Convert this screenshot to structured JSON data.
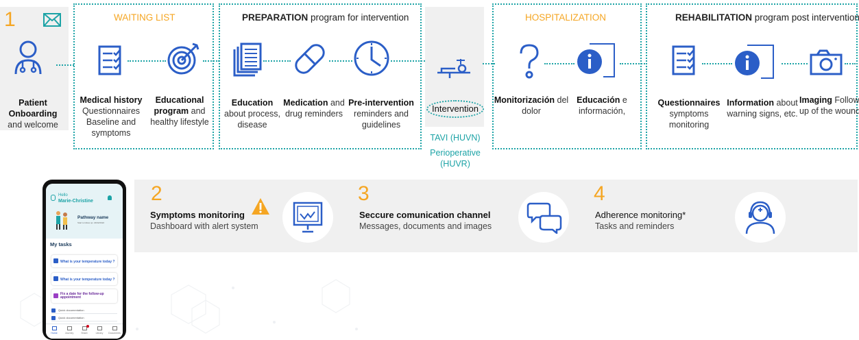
{
  "colors": {
    "accent_teal": "#1ca3a6",
    "orange": "#f5a623",
    "blue": "#2b5ec7",
    "panel_grey": "#f0f0f0"
  },
  "step1": {
    "number": "1",
    "mail_icon": "envelope-icon",
    "onboarding": {
      "icon": "doctor-icon",
      "line1": "Patient",
      "line2": "Onboarding",
      "line3": "and welcome"
    }
  },
  "waiting_list": {
    "title": "WAITING LIST",
    "items": [
      {
        "icon": "checklist-icon",
        "bold": "Medical history",
        "lines": [
          "Questionnaires",
          "Baseline and",
          "symptoms"
        ]
      },
      {
        "icon": "target-icon",
        "bold": "Educational",
        "bold2": "program",
        "rest": "and",
        "lines": [
          "healthy lifestyle"
        ]
      }
    ]
  },
  "preparation": {
    "title_bold": "PREPARATION",
    "title_rest": "program for intervention",
    "items": [
      {
        "icon": "documents-icon",
        "bold": "Education",
        "lines": [
          "about process,",
          "disease"
        ]
      },
      {
        "icon": "pill-icon",
        "bold": "Medication",
        "rest": "and",
        "lines": [
          "drug reminders"
        ]
      },
      {
        "icon": "clock-icon",
        "bold": "Pre-intervention",
        "lines": [
          "reminders and",
          "guidelines"
        ]
      }
    ]
  },
  "intervention": {
    "icon": "surgery-bed-icon",
    "label": "Intervention",
    "tavi": "TAVI (HUVN)",
    "periop1": "Perioperative",
    "periop2": "(HUVR)"
  },
  "hospitalization": {
    "title": "HOSPITALIZATION",
    "items": [
      {
        "icon": "question-icon",
        "bold": "Monitorización",
        "rest": "del",
        "lines": [
          "dolor"
        ]
      },
      {
        "icon": "info-icon",
        "bold": "Educación",
        "rest": "e",
        "lines": [
          "información,"
        ]
      }
    ]
  },
  "rehabilitation": {
    "title_bold": "REHABILITATION",
    "title_rest": "program post intervention",
    "items": [
      {
        "icon": "checklist-icon",
        "bold": "Questionnaires",
        "lines": [
          "symptoms",
          "monitoring"
        ]
      },
      {
        "icon": "info-icon",
        "bold": "Information",
        "rest": "about",
        "lines": [
          "warning signs, etc."
        ]
      },
      {
        "icon": "camera-icon",
        "bold": "Imaging",
        "rest": "Follow",
        "lines": [
          "up of the wound"
        ]
      }
    ]
  },
  "features": [
    {
      "number": "2",
      "title": "Symptoms monitoring",
      "subtitle": "Dashboard with alert system",
      "icon": "monitor-alert-icon",
      "warning_icon": "warning-icon"
    },
    {
      "number": "3",
      "title": "Seccure comunication channel",
      "subtitle": "Messages, documents and images",
      "icon": "chat-bubbles-icon"
    },
    {
      "number": "4",
      "title": "Adherence monitoring*",
      "subtitle": "Tasks and reminders",
      "icon": "nurse-headset-icon"
    }
  ],
  "phone": {
    "greeting": "Hello",
    "user": "Marie-Christine",
    "pathway_title": "Pathway name",
    "pathway_sub": "Start to follow up: 23/02/2022",
    "tasks_title": "My tasks",
    "tasks": [
      {
        "label": "What is your temperature today ?"
      },
      {
        "label": "What is your temperature today ?"
      },
      {
        "label": "Fix a date for the follow-up appointment"
      }
    ],
    "docs": [
      "Quick documentation",
      "Quick documentation"
    ],
    "nav": [
      "Home",
      "Journey",
      "Share",
      "Library",
      "Documents"
    ]
  }
}
